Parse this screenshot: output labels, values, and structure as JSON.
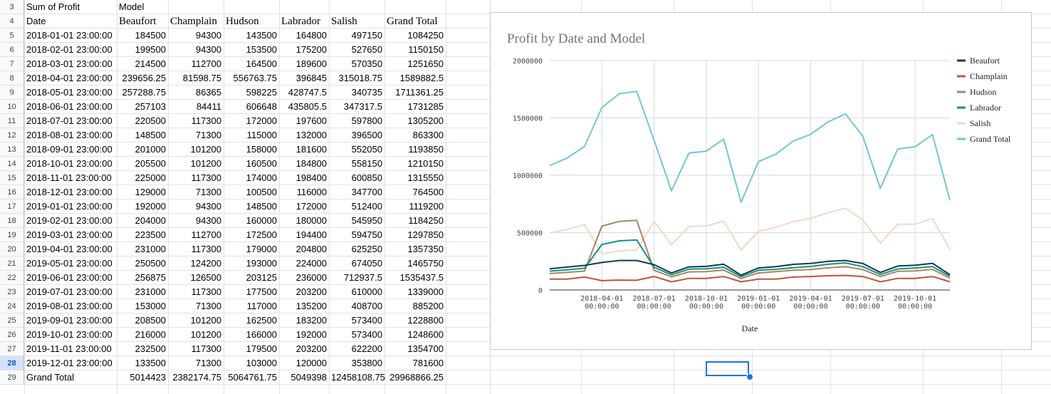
{
  "sheet": {
    "row_numbers": [
      3,
      4,
      5,
      6,
      7,
      8,
      9,
      10,
      11,
      12,
      13,
      14,
      15,
      16,
      17,
      18,
      19,
      20,
      21,
      22,
      23,
      24,
      25,
      26,
      27,
      28,
      29
    ],
    "selected_row": 28,
    "pivot_label": "Sum of Profit",
    "col_label": "Model",
    "headers": [
      "Date",
      "Beaufort",
      "Champlain",
      "Hudson",
      "Labrador",
      "Salish",
      "Grand Total"
    ],
    "rows": [
      [
        "2018-01-01 23:00:00",
        "184500",
        "94300",
        "143500",
        "164800",
        "497150",
        "1084250"
      ],
      [
        "2018-02-01 23:00:00",
        "199500",
        "94300",
        "153500",
        "175200",
        "527650",
        "1150150"
      ],
      [
        "2018-03-01 23:00:00",
        "214500",
        "112700",
        "164500",
        "189600",
        "570350",
        "1251650"
      ],
      [
        "2018-04-01 23:00:00",
        "239656.25",
        "81598.75",
        "556763.75",
        "396845",
        "315018.75",
        "1589882.5"
      ],
      [
        "2018-05-01 23:00:00",
        "257288.75",
        "86365",
        "598225",
        "428747.5",
        "340735",
        "1711361.25"
      ],
      [
        "2018-06-01 23:00:00",
        "257103",
        "84411",
        "606648",
        "435805.5",
        "347317.5",
        "1731285"
      ],
      [
        "2018-07-01 23:00:00",
        "220500",
        "117300",
        "172000",
        "197600",
        "597800",
        "1305200"
      ],
      [
        "2018-08-01 23:00:00",
        "148500",
        "71300",
        "115000",
        "132000",
        "396500",
        "863300"
      ],
      [
        "2018-09-01 23:00:00",
        "201000",
        "101200",
        "158000",
        "181600",
        "552050",
        "1193850"
      ],
      [
        "2018-10-01 23:00:00",
        "205500",
        "101200",
        "160500",
        "184800",
        "558150",
        "1210150"
      ],
      [
        "2018-11-01 23:00:00",
        "225000",
        "117300",
        "174000",
        "198400",
        "600850",
        "1315550"
      ],
      [
        "2018-12-01 23:00:00",
        "129000",
        "71300",
        "100500",
        "116000",
        "347700",
        "764500"
      ],
      [
        "2019-01-01 23:00:00",
        "192000",
        "94300",
        "148500",
        "172000",
        "512400",
        "1119200"
      ],
      [
        "2019-02-01 23:00:00",
        "204000",
        "94300",
        "160000",
        "180000",
        "545950",
        "1184250"
      ],
      [
        "2019-03-01 23:00:00",
        "223500",
        "112700",
        "172500",
        "194400",
        "594750",
        "1297850"
      ],
      [
        "2019-04-01 23:00:00",
        "231000",
        "117300",
        "179000",
        "204800",
        "625250",
        "1357350"
      ],
      [
        "2019-05-01 23:00:00",
        "250500",
        "124200",
        "193000",
        "224000",
        "674050",
        "1465750"
      ],
      [
        "2019-06-01 23:00:00",
        "256875",
        "126500",
        "203125",
        "236000",
        "712937.5",
        "1535437.5"
      ],
      [
        "2019-07-01 23:00:00",
        "231000",
        "117300",
        "177500",
        "203200",
        "610000",
        "1339000"
      ],
      [
        "2019-08-01 23:00:00",
        "153000",
        "71300",
        "117000",
        "135200",
        "408700",
        "885200"
      ],
      [
        "2019-09-01 23:00:00",
        "208500",
        "101200",
        "162500",
        "183200",
        "573400",
        "1228800"
      ],
      [
        "2019-10-01 23:00:00",
        "216000",
        "101200",
        "166000",
        "192000",
        "573400",
        "1248600"
      ],
      [
        "2019-11-01 23:00:00",
        "232500",
        "117300",
        "179500",
        "203200",
        "622200",
        "1354700"
      ],
      [
        "2019-12-01 23:00:00",
        "133500",
        "71300",
        "103000",
        "120000",
        "353800",
        "781600"
      ]
    ],
    "total_row": [
      "Grand Total",
      "5014423",
      "2382174.75",
      "5064761.75",
      "5049398",
      "12458108.75",
      "29968866.25"
    ]
  },
  "chart_data": {
    "type": "line",
    "title": "Profit by Date and Model",
    "xlabel": "Date",
    "ylabel": "",
    "ylim": [
      0,
      2000000
    ],
    "y_ticks": [
      "0",
      "500000",
      "1000000",
      "1500000",
      "2000000"
    ],
    "x_tick_labels": [
      [
        "2018-04-01",
        "00:00:00"
      ],
      [
        "2018-07-01",
        "00:00:00"
      ],
      [
        "2018-10-01",
        "00:00:00"
      ],
      [
        "2019-01-01",
        "00:00:00"
      ],
      [
        "2019-04-01",
        "00:00:00"
      ],
      [
        "2019-07-01",
        "00:00:00"
      ],
      [
        "2019-10-01",
        "00:00:00"
      ]
    ],
    "x_tick_indices": [
      3,
      6,
      9,
      12,
      15,
      18,
      21
    ],
    "legend_position": "right",
    "grid": true,
    "series": [
      {
        "name": "Beaufort",
        "color": "#0b3d52",
        "values": [
          184500,
          199500,
          214500,
          239656.25,
          257288.75,
          257103,
          220500,
          148500,
          201000,
          205500,
          225000,
          129000,
          192000,
          204000,
          223500,
          231000,
          250500,
          256875,
          231000,
          153000,
          208500,
          216000,
          232500,
          133500
        ]
      },
      {
        "name": "Champlain",
        "color": "#c0533e",
        "values": [
          94300,
          94300,
          112700,
          81598.75,
          86365,
          84411,
          117300,
          71300,
          101200,
          101200,
          117300,
          71300,
          94300,
          94300,
          112700,
          117300,
          124200,
          126500,
          117300,
          71300,
          101200,
          101200,
          117300,
          71300
        ]
      },
      {
        "name": "Hudson",
        "color": "#a98463",
        "values": [
          143500,
          153500,
          164500,
          556763.75,
          598225,
          606648,
          172000,
          115000,
          158000,
          160500,
          174000,
          100500,
          148500,
          160000,
          172500,
          179000,
          193000,
          203125,
          177500,
          117000,
          162500,
          166000,
          179500,
          103000
        ]
      },
      {
        "name": "Labrador",
        "color": "#16927e",
        "values": [
          164800,
          175200,
          189600,
          396845,
          428747.5,
          435805.5,
          197600,
          132000,
          181600,
          184800,
          198400,
          116000,
          172000,
          180000,
          194400,
          204800,
          224000,
          236000,
          203200,
          135200,
          183200,
          192000,
          203200,
          120000
        ]
      },
      {
        "name": "Salish",
        "color": "#f3d7c6",
        "values": [
          497150,
          527650,
          570350,
          315018.75,
          340735,
          347317.5,
          597800,
          396500,
          552050,
          558150,
          600850,
          347700,
          512400,
          545950,
          594750,
          625250,
          674050,
          712937.5,
          610000,
          408700,
          573400,
          573400,
          622200,
          353800
        ]
      },
      {
        "name": "Grand Total",
        "color": "#72c7d1",
        "values": [
          1084250,
          1150150,
          1251650,
          1589882.5,
          1711361.25,
          1731285,
          1305200,
          863300,
          1193850,
          1210150,
          1315550,
          764500,
          1119200,
          1184250,
          1297850,
          1357350,
          1465750,
          1535437.5,
          1339000,
          885200,
          1228800,
          1248600,
          1354700,
          781600
        ]
      }
    ]
  }
}
